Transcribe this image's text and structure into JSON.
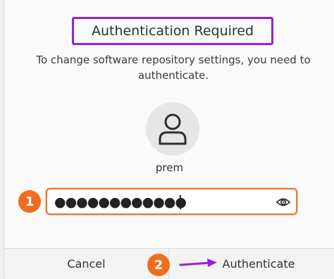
{
  "dialog": {
    "title": "Authentication Required",
    "description_line1": "To change software repository settings, you need to",
    "description_line2": "authenticate.",
    "username": "prem",
    "password_masked": "●●●●●●●●●●●●",
    "cancel_label": "Cancel",
    "authenticate_label": "Authenticate"
  },
  "annotations": {
    "step1": "1",
    "step2": "2"
  },
  "colors": {
    "highlight_box": "#9b1fd8",
    "badge": "#f06d1d",
    "arrow": "#9b1fd8",
    "field_focus": "#e8773a"
  },
  "icons": {
    "avatar": "user-icon",
    "password_toggle": "eye-icon",
    "arrow": "arrow-right-icon"
  }
}
